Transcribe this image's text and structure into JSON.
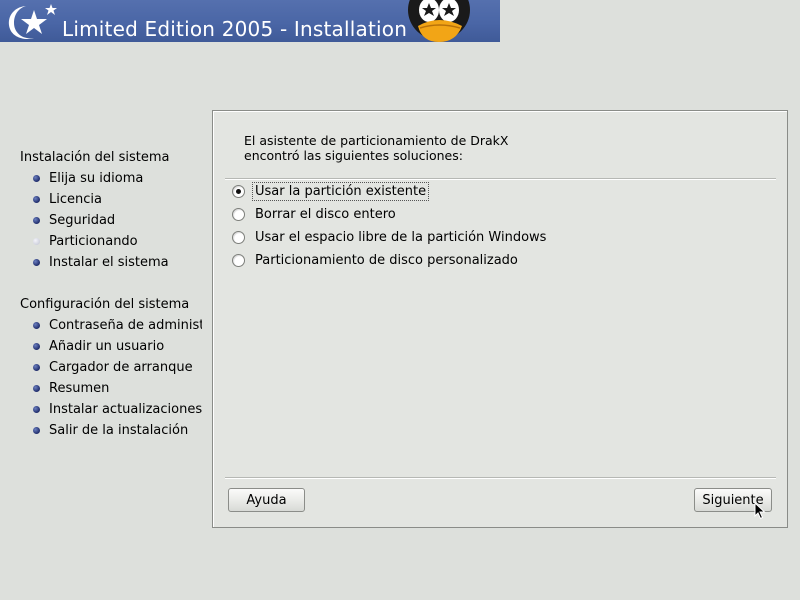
{
  "banner": {
    "title": "Limited Edition 2005 - Installation"
  },
  "sidebar": {
    "sections": [
      {
        "title": "Instalación del sistema",
        "items": [
          {
            "label": "Elija su idioma",
            "state": "done"
          },
          {
            "label": "Licencia",
            "state": "done"
          },
          {
            "label": "Seguridad",
            "state": "done"
          },
          {
            "label": "Particionando",
            "state": "current"
          },
          {
            "label": "Instalar el sistema",
            "state": "pending"
          }
        ]
      },
      {
        "title": "Configuración del sistema",
        "items": [
          {
            "label": "Contraseña de administi",
            "state": "pending"
          },
          {
            "label": "Añadir un usuario",
            "state": "pending"
          },
          {
            "label": "Cargador de arranque",
            "state": "pending"
          },
          {
            "label": "Resumen",
            "state": "pending"
          },
          {
            "label": "Instalar actualizaciones",
            "state": "pending"
          },
          {
            "label": "Salir de la instalación",
            "state": "pending"
          }
        ]
      }
    ]
  },
  "main": {
    "intro_line1": "El asistente de particionamiento de DrakX",
    "intro_line2": "encontró las siguientes soluciones:",
    "options": [
      {
        "label": "Usar la partición existente",
        "checked": true
      },
      {
        "label": "Borrar el disco entero",
        "checked": false
      },
      {
        "label": "Usar el espacio libre de la partición Windows",
        "checked": false
      },
      {
        "label": "Particionamiento de disco personalizado",
        "checked": false
      }
    ],
    "help_label": "Ayuda",
    "next_label": "Siguiente"
  },
  "colors": {
    "banner": "#4a66a6",
    "background": "#dde0dc",
    "bullet": "#1e2c6a"
  }
}
